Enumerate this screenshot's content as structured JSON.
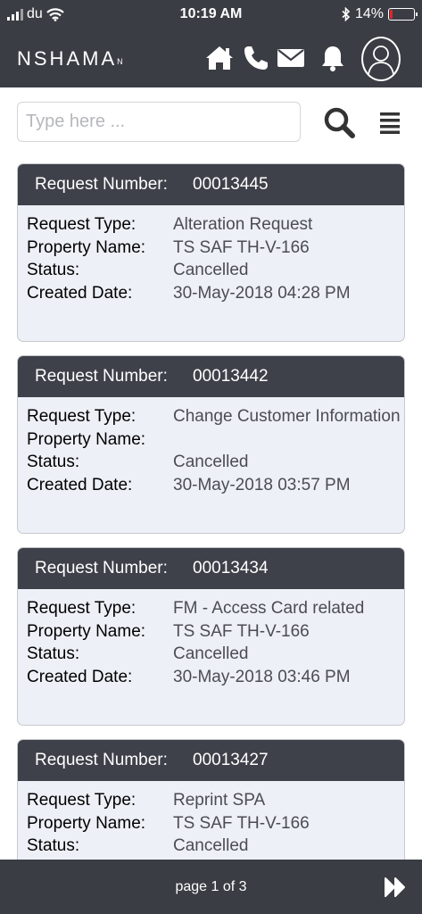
{
  "status_bar": {
    "carrier": "du",
    "time": "10:19 AM",
    "battery": "14%",
    "battery_level": 0.14
  },
  "header": {
    "brand": "NSHAMA",
    "brand_mark": "N"
  },
  "search": {
    "placeholder": "Type here ..."
  },
  "labels": {
    "request_number": "Request Number:",
    "request_type": "Request Type:",
    "property_name": "Property Name:",
    "status": "Status:",
    "created_date": "Created Date:"
  },
  "requests": [
    {
      "number": "00013445",
      "type": "Alteration Request",
      "property": "TS SAF TH-V-166",
      "status": "Cancelled",
      "created": "30-May-2018 04:28 PM"
    },
    {
      "number": "00013442",
      "type": "Change Customer Information",
      "property": "",
      "status": "Cancelled",
      "created": "30-May-2018 03:57 PM"
    },
    {
      "number": "00013434",
      "type": "FM - Access Card related",
      "property": "TS SAF TH-V-166",
      "status": "Cancelled",
      "created": "30-May-2018 03:46 PM"
    },
    {
      "number": "00013427",
      "type": "Reprint SPA",
      "property": "TS SAF TH-V-166",
      "status": "Cancelled",
      "created": ""
    }
  ],
  "footer": {
    "page_info": "page 1 of 3"
  },
  "icons": [
    "home-icon",
    "phone-icon",
    "mail-icon",
    "bell-icon",
    "profile-icon",
    "search-icon",
    "menu-icon",
    "fast-forward-icon"
  ]
}
